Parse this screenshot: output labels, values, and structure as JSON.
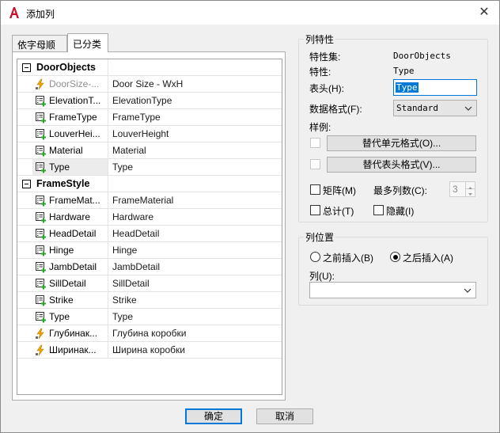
{
  "window": {
    "title": "添加列",
    "close_glyph": "✕",
    "icon": "autocad-a-icon"
  },
  "tabs": [
    {
      "label": "依字母顺序",
      "active": false
    },
    {
      "label": "已分类",
      "active": true
    }
  ],
  "property_grid": {
    "categories": [
      {
        "name": "DoorObjects",
        "rows": [
          {
            "name": "DoorSize-...",
            "value": "Door Size - WxH",
            "icon": "formula-property-icon",
            "dimmed": true
          },
          {
            "name": "ElevationT...",
            "value": "ElevationType",
            "icon": "property-add-icon"
          },
          {
            "name": "FrameType",
            "value": "FrameType",
            "icon": "property-add-icon"
          },
          {
            "name": "LouverHei...",
            "value": "LouverHeight",
            "icon": "property-add-icon"
          },
          {
            "name": "Material",
            "value": "Material",
            "icon": "property-add-icon"
          },
          {
            "name": "Type",
            "value": "Type",
            "icon": "property-add-icon",
            "selected": true
          }
        ]
      },
      {
        "name": "FrameStyle",
        "rows": [
          {
            "name": "FrameMat...",
            "value": "FrameMaterial",
            "icon": "property-add-icon"
          },
          {
            "name": "Hardware",
            "value": "Hardware",
            "icon": "property-add-icon"
          },
          {
            "name": "HeadDetail",
            "value": "HeadDetail",
            "icon": "property-add-icon"
          },
          {
            "name": "Hinge",
            "value": "Hinge",
            "icon": "property-add-icon"
          },
          {
            "name": "JambDetail",
            "value": "JambDetail",
            "icon": "property-add-icon"
          },
          {
            "name": "SillDetail",
            "value": "SillDetail",
            "icon": "property-add-icon"
          },
          {
            "name": "Strike",
            "value": "Strike",
            "icon": "property-add-icon"
          },
          {
            "name": "Type",
            "value": "Type",
            "icon": "property-add-icon"
          },
          {
            "name": "Глубинак...",
            "value": "Глубина коробки",
            "icon": "formula-property-icon"
          },
          {
            "name": "Ширинак...",
            "value": "Ширина коробки",
            "icon": "formula-property-icon"
          }
        ]
      }
    ]
  },
  "column_props": {
    "group_title": "列特性",
    "propset_label": "特性集:",
    "propset_value": "DoorObjects",
    "property_label": "特性:",
    "property_value": "Type",
    "header_label": "表头(H):",
    "header_value": "Type",
    "format_label": "数据格式(F):",
    "format_value": "Standard",
    "sample_label": "样例:",
    "override_cell_btn": "替代单元格式(O)...",
    "override_header_btn": "替代表头格式(V)...",
    "matrix_label": "矩阵(M)",
    "max_cols_label": "最多列数(C):",
    "max_cols_value": "3",
    "total_label": "总计(T)",
    "hide_label": "隐藏(I)"
  },
  "column_position": {
    "group_title": "列位置",
    "insert_before_label": "之前插入(B)",
    "insert_after_label": "之后插入(A)",
    "selected": "after",
    "column_label": "列(U):",
    "column_value": ""
  },
  "footer": {
    "ok_label": "确定",
    "cancel_label": "取消"
  },
  "colors": {
    "accent": "#0078d7",
    "app_icon_red": "#c8102e"
  }
}
